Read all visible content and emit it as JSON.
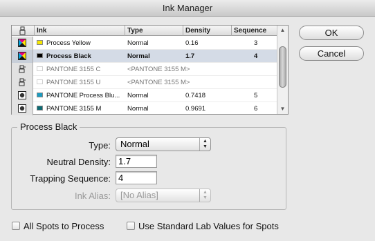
{
  "window": {
    "title": "Ink Manager"
  },
  "table": {
    "columns": [
      "",
      "Ink",
      "Type",
      "Density",
      "Sequence"
    ],
    "rows": [
      {
        "icon": "process-ink-icon",
        "swatch": "#f5e600",
        "name": "Process Yellow",
        "type": "Normal",
        "density": "0.16",
        "sequence": "3",
        "selected": false,
        "dim": false
      },
      {
        "icon": "process-ink-icon",
        "swatch": "#000000",
        "name": "Process Black",
        "type": "Normal",
        "density": "1.7",
        "sequence": "4",
        "selected": true,
        "dim": false
      },
      {
        "icon": "ink-alias-icon",
        "swatch": "",
        "name": "PANTONE 3155 C",
        "type": "<PANTONE 3155 M>",
        "density": "",
        "sequence": "",
        "selected": false,
        "dim": true
      },
      {
        "icon": "ink-alias-icon",
        "swatch": "",
        "name": "PANTONE 3155 U",
        "type": "<PANTONE 3155 M>",
        "density": "",
        "sequence": "",
        "selected": false,
        "dim": true
      },
      {
        "icon": "spot-ink-icon",
        "swatch": "#1b9cc1",
        "name": "PANTONE Process Blu...",
        "type": "Normal",
        "density": "0.7418",
        "sequence": "5",
        "selected": false,
        "dim": false
      },
      {
        "icon": "spot-ink-icon",
        "swatch": "#0d6a72",
        "name": "PANTONE 3155 M",
        "type": "Normal",
        "density": "0.9691",
        "sequence": "6",
        "selected": false,
        "dim": false
      }
    ]
  },
  "buttons": {
    "ok": "OK",
    "cancel": "Cancel"
  },
  "details": {
    "group_title": "Process Black",
    "type_label": "Type:",
    "type_value": "Normal",
    "neutral_density_label": "Neutral Density:",
    "neutral_density_value": "1.7",
    "trapping_sequence_label": "Trapping Sequence:",
    "trapping_sequence_value": "4",
    "ink_alias_label": "Ink Alias:",
    "ink_alias_value": "[No Alias]"
  },
  "options": {
    "all_spots_to_process": "All Spots to Process",
    "use_standard_lab": "Use Standard Lab Values for Spots"
  }
}
